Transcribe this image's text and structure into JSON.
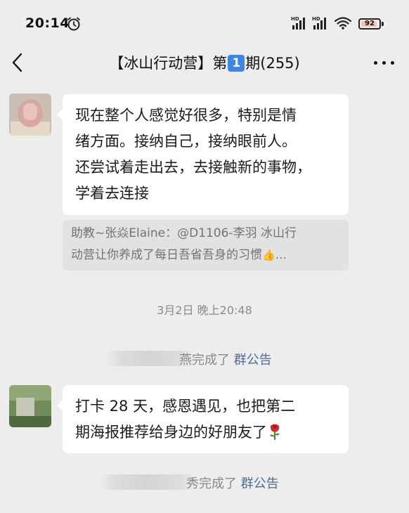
{
  "status_bar": {
    "time": "20:14",
    "alarm_icon": "alarm-clock-icon",
    "signal_label_1": "HD",
    "signal_label_2": "HD",
    "battery_level": "92",
    "battery_color": "#ff7a3d"
  },
  "nav": {
    "title_prefix": "【冰山行动营】第",
    "title_badge": "1",
    "title_suffix": "期(255)",
    "back_icon": "back-chevron-icon",
    "more_icon": "more-dots-icon",
    "badge_color": "#3d86e6"
  },
  "messages": [
    {
      "text_lines": [
        "现在整个人感觉好很多，特别是情",
        "绪方面。接纳自己，接纳眼前人。",
        "还尝试着走出去，去接触新的事物，",
        "学着去连接"
      ],
      "quote_lines": [
        "助教~张焱Elaine：@D1106-李羽 冰山行",
        "动营让你养成了每日吾省吾身的习惯"
      ],
      "quote_emoji": "👍",
      "quote_ellipsis": "..."
    },
    {
      "text_lines": [
        "打卡 28 天，感恩遇见，也把第二",
        "期海报推荐给身边的好朋友了"
      ],
      "emoji_icon": "rose-icon"
    }
  ],
  "timestamp": "3月2日 晚上20:48",
  "system_notices": [
    {
      "name_tail": "燕完成了",
      "link": "群公告"
    },
    {
      "name_tail": "秀完成了",
      "link": "群公告"
    }
  ]
}
